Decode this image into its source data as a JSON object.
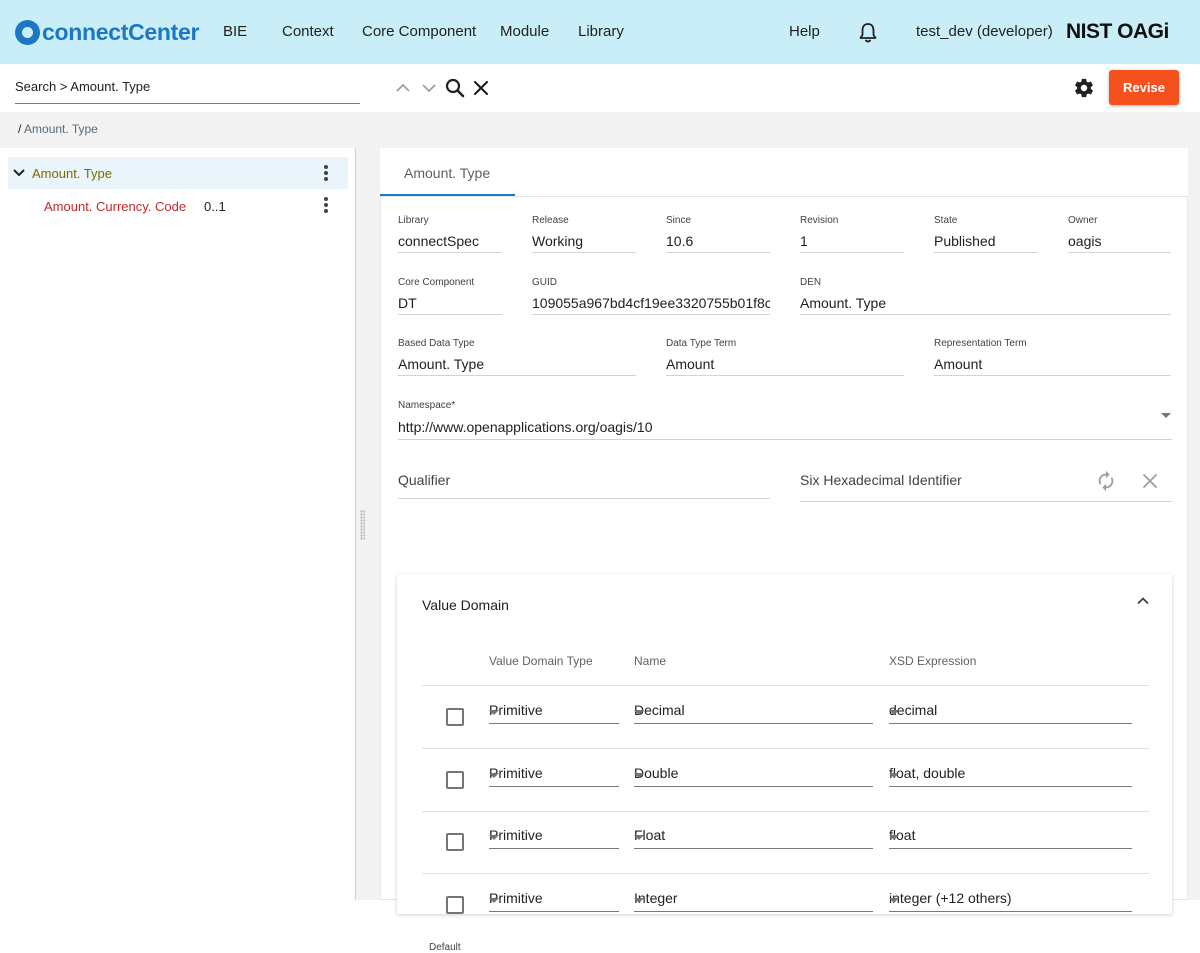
{
  "nav": {
    "brand": "connectCenter",
    "items": [
      "BIE",
      "Context",
      "Core Component",
      "Module",
      "Library"
    ],
    "help": "Help",
    "user": "test_dev (developer)",
    "org_logo": "NIST OAGi"
  },
  "search": {
    "value": "Search > Amount. Type",
    "revise_label": "Revise"
  },
  "breadcrumb": {
    "separator": "/",
    "current": "Amount. Type"
  },
  "tree": {
    "root_label": "Amount. Type",
    "child_label": "Amount. Currency. Code",
    "child_cardinality": "0..1"
  },
  "detail": {
    "tab_label": "Amount. Type",
    "library_label": "Library",
    "library": "connectSpec",
    "release_label": "Release",
    "release": "Working",
    "since_label": "Since",
    "since": "10.6",
    "revision_label": "Revision",
    "revision": "1",
    "state_label": "State",
    "state": "Published",
    "owner_label": "Owner",
    "owner": "oagis",
    "core_component_label": "Core Component",
    "core_component": "DT",
    "guid_label": "GUID",
    "guid": "109055a967bd4cf19ee3320755b01f8c",
    "den_label": "DEN",
    "den": "Amount. Type",
    "based_data_type_label": "Based Data Type",
    "based_data_type": "Amount. Type",
    "data_type_term_label": "Data Type Term",
    "data_type_term": "Amount",
    "representation_term_label": "Representation Term",
    "representation_term": "Amount",
    "namespace_label": "Namespace*",
    "namespace": "http://www.openapplications.org/oagis/10",
    "qualifier_placeholder": "Qualifier",
    "six_hex_placeholder": "Six Hexadecimal Identifier"
  },
  "value_domain": {
    "title": "Value Domain",
    "columns": [
      "Value Domain Type",
      "Name",
      "XSD Expression"
    ],
    "rows": [
      {
        "type": "Primitive",
        "name": "Decimal",
        "xsd": "decimal"
      },
      {
        "type": "Primitive",
        "name": "Double",
        "xsd": "float, double"
      },
      {
        "type": "Primitive",
        "name": "Float",
        "xsd": "float"
      },
      {
        "type": "Primitive",
        "name": "Integer",
        "xsd": "integer  (+12 others)"
      }
    ],
    "default_label": "Default"
  },
  "colors": {
    "nav_bg": "#c9eef7",
    "brand": "#1d77c2",
    "revise": "#f4511e",
    "tree_root": "#7a6a00",
    "tree_child": "#c62828"
  }
}
